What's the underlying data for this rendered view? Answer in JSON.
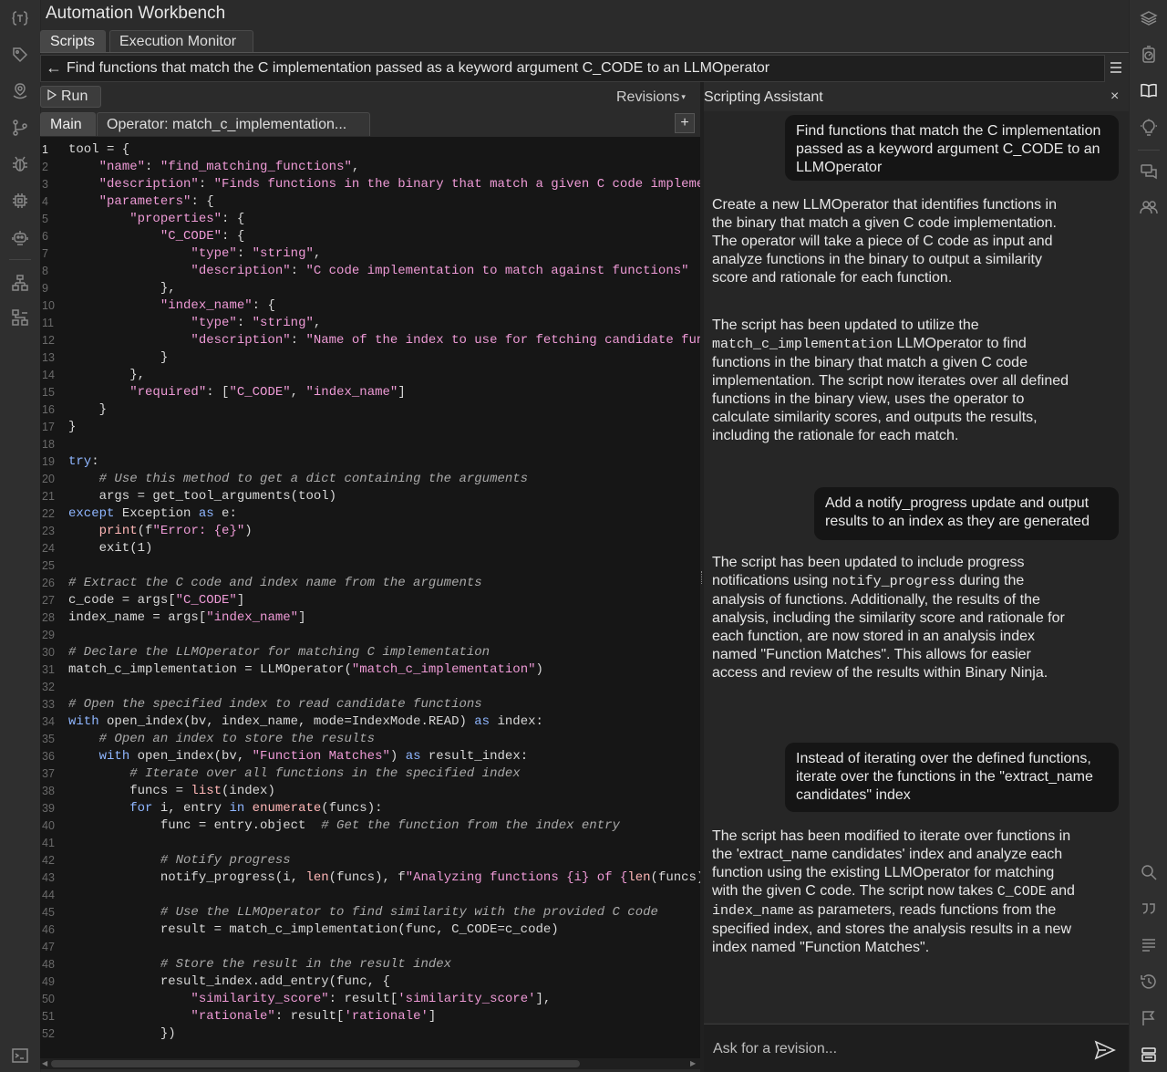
{
  "app": {
    "title": "Automation Workbench"
  },
  "tabs": [
    {
      "label": "Scripts"
    },
    {
      "label": "Execution Monitor"
    }
  ],
  "query": {
    "text": "Find functions that match the C implementation passed as a keyword argument C_CODE to an LLMOperator"
  },
  "toolbar": {
    "run_label": "Run",
    "revisions_label": "Revisions"
  },
  "editor": {
    "tabs": [
      {
        "label": "Main"
      },
      {
        "label": "Operator: match_c_implementation..."
      }
    ],
    "add_tab_label": "+"
  },
  "assistant": {
    "title": "Scripting Assistant",
    "close_label": "×",
    "messages": [
      {
        "role": "user",
        "text": "Find functions that match the C implementation passed as a keyword argument C_CODE to an LLMOperator"
      },
      {
        "role": "assistant",
        "parts": [
          {
            "text": "Create a new LLMOperator that identifies functions in the binary that match a given C code implementation. The operator will take a piece of C code as input and analyze functions in the binary to output a similarity score and rationale for each function."
          }
        ]
      },
      {
        "role": "assistant",
        "parts": [
          {
            "text": "The script has been updated to utilize the "
          },
          {
            "code": "match_c_implementation"
          },
          {
            "text": " LLMOperator to find functions in the binary that match a given C code implementation. The script now iterates over all defined functions in the binary view, uses the operator to calculate similarity scores, and outputs the results, including the rationale for each match."
          }
        ]
      },
      {
        "role": "user",
        "text": "Add a notify_progress update and output results to an index as they are generated"
      },
      {
        "role": "assistant",
        "parts": [
          {
            "text": "The script has been updated to include progress notifications using "
          },
          {
            "code": "notify_progress"
          },
          {
            "text": " during the analysis of functions. Additionally, the results of the analysis, including the similarity score and rationale for each function, are now stored in an analysis index named \"Function Matches\". This allows for easier access and review of the results within Binary Ninja."
          }
        ]
      },
      {
        "role": "user",
        "text": "Instead of iterating over the defined functions, iterate over the functions in the \"extract_name candidates\" index"
      },
      {
        "role": "assistant",
        "parts": [
          {
            "text": "The script has been modified to iterate over functions in the 'extract_name candidates' index and analyze each function using the existing LLMOperator for matching with the given C code. The script now takes "
          },
          {
            "code": "C_CODE"
          },
          {
            "text": " and "
          },
          {
            "code": "index_name"
          },
          {
            "text": " as parameters, reads functions from the specified index, and stores the analysis results in a new index named \"Function Matches\"."
          }
        ]
      }
    ],
    "input_placeholder": "Ask for a revision..."
  },
  "code_lines": [
    [
      [
        "tool = {",
        ""
      ]
    ],
    [
      [
        "    ",
        ""
      ],
      [
        "\"name\"",
        "s"
      ],
      [
        ": ",
        ""
      ],
      [
        "\"find_matching_functions\"",
        "s"
      ],
      [
        ",",
        ""
      ]
    ],
    [
      [
        "    ",
        ""
      ],
      [
        "\"description\"",
        "s"
      ],
      [
        ": ",
        ""
      ],
      [
        "\"Finds functions in the binary that match a given C code implementation\"",
        "s"
      ],
      [
        ",",
        ""
      ]
    ],
    [
      [
        "    ",
        ""
      ],
      [
        "\"parameters\"",
        "s"
      ],
      [
        ": {",
        ""
      ]
    ],
    [
      [
        "        ",
        ""
      ],
      [
        "\"properties\"",
        "s"
      ],
      [
        ": {",
        ""
      ]
    ],
    [
      [
        "            ",
        ""
      ],
      [
        "\"C_CODE\"",
        "s"
      ],
      [
        ": {",
        ""
      ]
    ],
    [
      [
        "                ",
        ""
      ],
      [
        "\"type\"",
        "s"
      ],
      [
        ": ",
        ""
      ],
      [
        "\"string\"",
        "s"
      ],
      [
        ",",
        ""
      ]
    ],
    [
      [
        "                ",
        ""
      ],
      [
        "\"description\"",
        "s"
      ],
      [
        ": ",
        ""
      ],
      [
        "\"C code implementation to match against functions\"",
        "s"
      ]
    ],
    [
      [
        "            },",
        ""
      ]
    ],
    [
      [
        "            ",
        ""
      ],
      [
        "\"index_name\"",
        "s"
      ],
      [
        ": {",
        ""
      ]
    ],
    [
      [
        "                ",
        ""
      ],
      [
        "\"type\"",
        "s"
      ],
      [
        ": ",
        ""
      ],
      [
        "\"string\"",
        "s"
      ],
      [
        ",",
        ""
      ]
    ],
    [
      [
        "                ",
        ""
      ],
      [
        "\"description\"",
        "s"
      ],
      [
        ": ",
        ""
      ],
      [
        "\"Name of the index to use for fetching candidate functions\"",
        "s"
      ]
    ],
    [
      [
        "            }",
        ""
      ]
    ],
    [
      [
        "        },",
        ""
      ]
    ],
    [
      [
        "        ",
        ""
      ],
      [
        "\"required\"",
        "s"
      ],
      [
        ": [",
        ""
      ],
      [
        "\"C_CODE\"",
        "s"
      ],
      [
        ", ",
        ""
      ],
      [
        "\"index_name\"",
        "s"
      ],
      [
        "]",
        ""
      ]
    ],
    [
      [
        "    }",
        ""
      ]
    ],
    [
      [
        "}",
        ""
      ]
    ],
    [],
    [
      [
        "try",
        "k"
      ],
      [
        ":",
        ""
      ]
    ],
    [
      [
        "    ",
        ""
      ],
      [
        "# Use this method to get a dict containing the arguments",
        "c"
      ]
    ],
    [
      [
        "    args = get_tool_arguments(tool)",
        ""
      ]
    ],
    [
      [
        "except",
        "k"
      ],
      [
        " Exception ",
        ""
      ],
      [
        "as",
        "k"
      ],
      [
        " e:",
        ""
      ]
    ],
    [
      [
        "    ",
        ""
      ],
      [
        "print",
        "f"
      ],
      [
        "(f",
        ""
      ],
      [
        "\"Error: {e}\"",
        "s"
      ],
      [
        ")",
        ""
      ]
    ],
    [
      [
        "    exit(1)",
        ""
      ]
    ],
    [],
    [
      [
        "# Extract the C code and index name from the arguments",
        "c"
      ]
    ],
    [
      [
        "c_code = args[",
        ""
      ],
      [
        "\"C_CODE\"",
        "s"
      ],
      [
        "]",
        ""
      ]
    ],
    [
      [
        "index_name = args[",
        ""
      ],
      [
        "\"index_name\"",
        "s"
      ],
      [
        "]",
        ""
      ]
    ],
    [],
    [
      [
        "# Declare the LLMOperator for matching C implementation",
        "c"
      ]
    ],
    [
      [
        "match_c_implementation = LLMOperator(",
        ""
      ],
      [
        "\"match_c_implementation\"",
        "s"
      ],
      [
        ")",
        ""
      ]
    ],
    [],
    [
      [
        "# Open the specified index to read candidate functions",
        "c"
      ]
    ],
    [
      [
        "with",
        "k"
      ],
      [
        " open_index(bv, index_name, mode=IndexMode.READ) ",
        ""
      ],
      [
        "as",
        "k"
      ],
      [
        " index:",
        ""
      ]
    ],
    [
      [
        "    ",
        ""
      ],
      [
        "# Open an index to store the results",
        "c"
      ]
    ],
    [
      [
        "    ",
        ""
      ],
      [
        "with",
        "k"
      ],
      [
        " open_index(bv, ",
        ""
      ],
      [
        "\"Function Matches\"",
        "s"
      ],
      [
        ") ",
        ""
      ],
      [
        "as",
        "k"
      ],
      [
        " result_index:",
        ""
      ]
    ],
    [
      [
        "        ",
        ""
      ],
      [
        "# Iterate over all functions in the specified index",
        "c"
      ]
    ],
    [
      [
        "        funcs = ",
        ""
      ],
      [
        "list",
        "f"
      ],
      [
        "(index)",
        ""
      ]
    ],
    [
      [
        "        ",
        ""
      ],
      [
        "for",
        "k"
      ],
      [
        " i, entry ",
        ""
      ],
      [
        "in",
        "k"
      ],
      [
        " ",
        ""
      ],
      [
        "enumerate",
        "f"
      ],
      [
        "(funcs):",
        ""
      ]
    ],
    [
      [
        "            func = entry.object  ",
        ""
      ],
      [
        "# Get the function from the index entry",
        "c"
      ]
    ],
    [],
    [
      [
        "            ",
        ""
      ],
      [
        "# Notify progress",
        "c"
      ]
    ],
    [
      [
        "            notify_progress(i, ",
        ""
      ],
      [
        "len",
        "f"
      ],
      [
        "(funcs), f",
        ""
      ],
      [
        "\"Analyzing functions {i} of {",
        "s"
      ],
      [
        "len",
        "f"
      ],
      [
        "(funcs)}: ",
        ""
      ],
      [
        "r",
        "s"
      ]
    ],
    [],
    [
      [
        "            ",
        ""
      ],
      [
        "# Use the LLMOperator to find similarity with the provided C code",
        "c"
      ]
    ],
    [
      [
        "            result = match_c_implementation(func, C_CODE=c_code)",
        ""
      ]
    ],
    [],
    [
      [
        "            ",
        ""
      ],
      [
        "# Store the result in the result index",
        "c"
      ]
    ],
    [
      [
        "            result_index.add_entry(func, {",
        ""
      ]
    ],
    [
      [
        "                ",
        ""
      ],
      [
        "\"similarity_score\"",
        "s"
      ],
      [
        ": result[",
        ""
      ],
      [
        "'similarity_score'",
        "s"
      ],
      [
        "],",
        ""
      ]
    ],
    [
      [
        "                ",
        ""
      ],
      [
        "\"rationale\"",
        "s"
      ],
      [
        ": result[",
        ""
      ],
      [
        "'rationale'",
        "s"
      ],
      [
        "]",
        ""
      ]
    ],
    [
      [
        "            })",
        ""
      ]
    ]
  ]
}
